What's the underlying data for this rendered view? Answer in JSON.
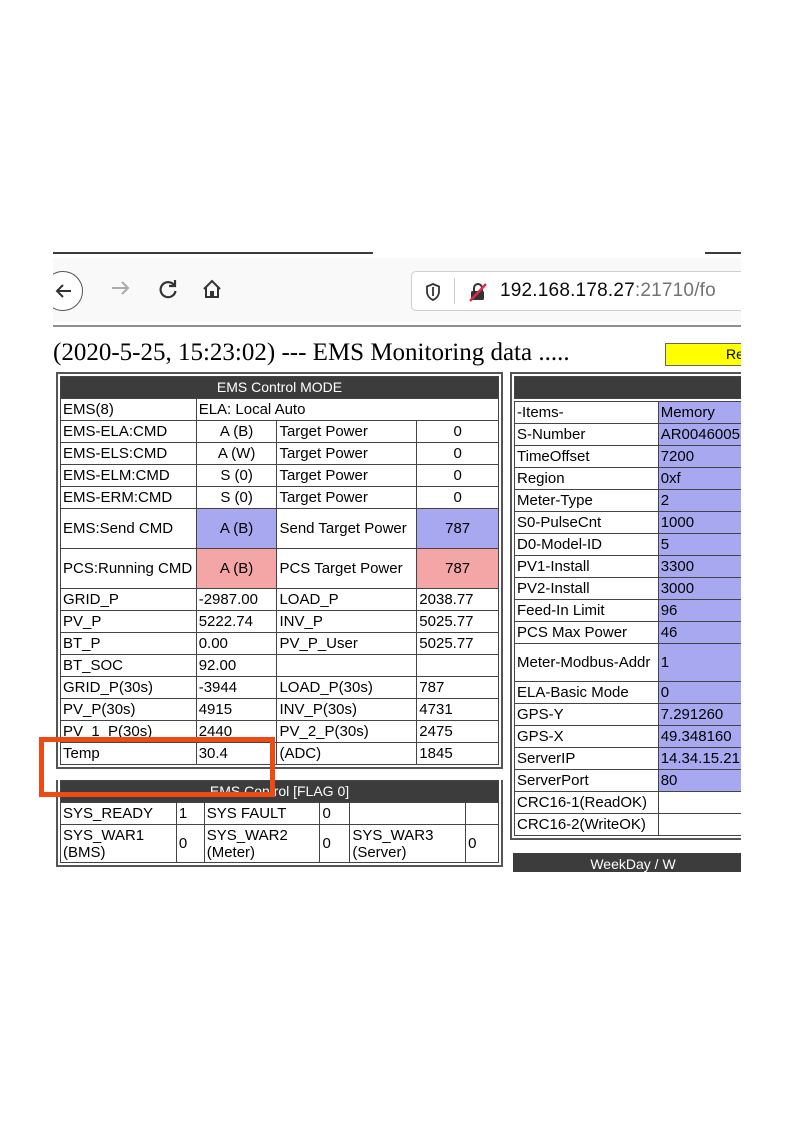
{
  "browser": {
    "back_icon": "arrow-left-icon",
    "forward_icon": "arrow-right-icon",
    "reload_icon": "reload-icon",
    "home_icon": "home-icon",
    "url_host": "192.168.178.27",
    "url_rest": ":21710/fo"
  },
  "page": {
    "heading": "(2020-5-25, 15:23:02) --- EMS Monitoring data .....",
    "reload_button": "Re"
  },
  "control": {
    "title": "EMS Control MODE",
    "ems_label": "EMS(8)",
    "ems_value": "ELA: Local Auto",
    "cmd_rows": [
      {
        "label": "EMS-ELA:CMD",
        "mode": "A (B)",
        "tp": "Target Power",
        "val": "0"
      },
      {
        "label": "EMS-ELS:CMD",
        "mode": "A (W)",
        "tp": "Target Power",
        "val": "0"
      },
      {
        "label": "EMS-ELM:CMD",
        "mode": "S (0)",
        "tp": "Target Power",
        "val": "0"
      },
      {
        "label": "EMS-ERM:CMD",
        "mode": "S (0)",
        "tp": "Target Power",
        "val": "0"
      }
    ],
    "send": {
      "label": "EMS:Send CMD",
      "mode": "A (B)",
      "tp": "Send Target Power",
      "val": "787"
    },
    "pcs": {
      "label": "PCS:Running CMD",
      "mode": "A (B)",
      "tp": "PCS Target Power",
      "val": "787"
    },
    "data_rows": [
      {
        "k1": "GRID_P",
        "v1": "-2987.00",
        "k2": "LOAD_P",
        "v2": "2038.77"
      },
      {
        "k1": "PV_P",
        "v1": "5222.74",
        "k2": "INV_P",
        "v2": "5025.77"
      },
      {
        "k1": "BT_P",
        "v1": "0.00",
        "k2": "PV_P_User",
        "v2": "5025.77"
      },
      {
        "k1": "BT_SOC",
        "v1": "92.00",
        "k2": "",
        "v2": ""
      },
      {
        "k1": "GRID_P(30s)",
        "v1": "-3944",
        "k2": "LOAD_P(30s)",
        "v2": "787"
      },
      {
        "k1": "PV_P(30s)",
        "v1": "4915",
        "k2": "INV_P(30s)",
        "v2": "4731"
      },
      {
        "k1": "PV_1_P(30s)",
        "v1": "2440",
        "k2": "PV_2_P(30s)",
        "v2": "2475"
      },
      {
        "k1": "Temp",
        "v1": "30.4",
        "k2": "(ADC)",
        "v2": "1845"
      }
    ]
  },
  "flags": {
    "title": "EMS Control [FLAG 0]",
    "row1": {
      "a": "SYS_READY",
      "av": "1",
      "b": "SYS FAULT",
      "bv": "0"
    },
    "row2": {
      "a": "SYS_WAR1 (BMS)",
      "av": "0",
      "b": "SYS_WAR2 (Meter)",
      "bv": "0",
      "c": "SYS_WAR3 (Server)",
      "cv": "0"
    }
  },
  "memory": {
    "header_label": "-Items-",
    "header_value": "Memory",
    "rows": [
      {
        "k": "S-Number",
        "v": "AR0046005"
      },
      {
        "k": "TimeOffset",
        "v": "7200"
      },
      {
        "k": "Region",
        "v": "0xf"
      },
      {
        "k": "Meter-Type",
        "v": "2"
      },
      {
        "k": "S0-PulseCnt",
        "v": "1000"
      },
      {
        "k": "D0-Model-ID",
        "v": "5"
      },
      {
        "k": "PV1-Install",
        "v": "3300"
      },
      {
        "k": "PV2-Install",
        "v": "3000"
      },
      {
        "k": "Feed-In Limit",
        "v": "96"
      },
      {
        "k": "PCS Max Power",
        "v": "46"
      },
      {
        "k": "Meter-Modbus-Addr",
        "v": "1"
      },
      {
        "k": "ELA-Basic Mode",
        "v": "0"
      },
      {
        "k": "GPS-Y",
        "v": "7.291260"
      },
      {
        "k": "GPS-X",
        "v": "49.348160"
      },
      {
        "k": "ServerIP",
        "v": "14.34.15.21"
      },
      {
        "k": "ServerPort",
        "v": "80"
      },
      {
        "k": "CRC16-1(ReadOK)",
        "v": ""
      },
      {
        "k": "CRC16-2(WriteOK)",
        "v": ""
      }
    ],
    "week_title": "WeekDay / W"
  },
  "colors": {
    "highlight": "#ef4a14",
    "blue_cell": "#a8a8f0",
    "pink_cell": "#f4a6a6",
    "header_bg": "#3c3c3c",
    "reload_bg": "#ffff00"
  }
}
